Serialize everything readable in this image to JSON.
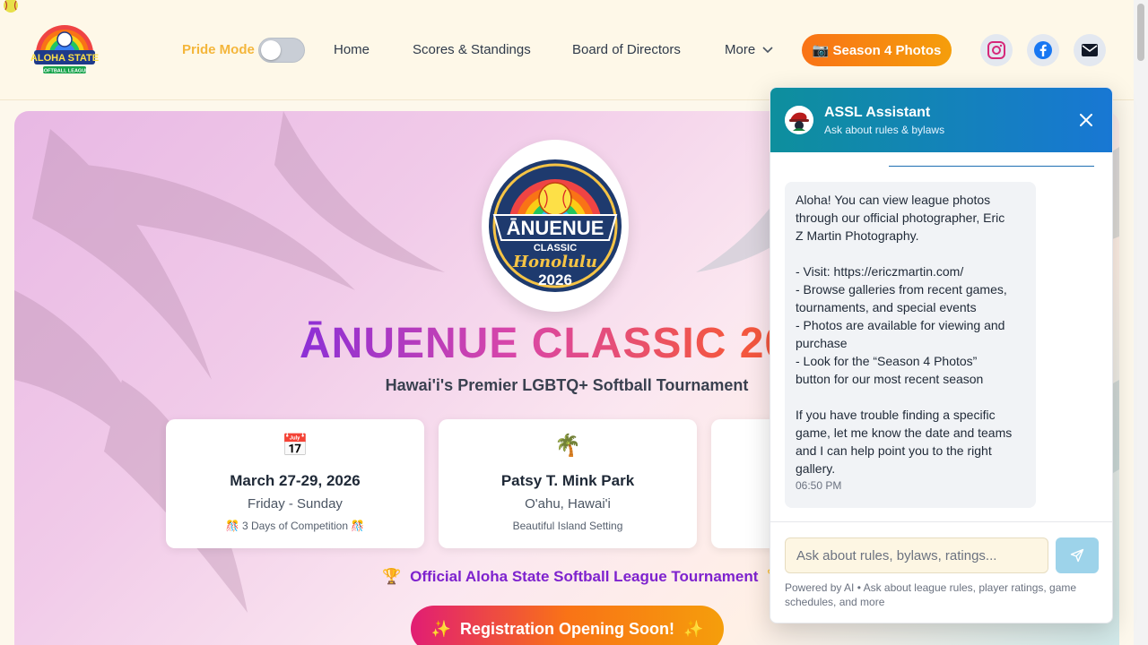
{
  "header": {
    "logo_alt": "Aloha State Softball League",
    "pride_mode_label": "Pride Mode",
    "nav": [
      {
        "label": "Home"
      },
      {
        "label": "Scores & Standings"
      },
      {
        "label": "Board of Directors"
      },
      {
        "label": "More"
      }
    ],
    "season_photos_label": "📷 Season 4 Photos",
    "social_icons": [
      "instagram-icon",
      "facebook-icon",
      "email-icon"
    ],
    "colors": {
      "accent": "#f97316",
      "pride_label": "#f4b63b"
    }
  },
  "hero": {
    "badge": {
      "line1": "ĀNUENUE",
      "line2": "CLASSIC",
      "line3": "Honolulu",
      "line4": "2026"
    },
    "title": "ĀNUENUE CLASSIC 2026",
    "subtitle": "Hawai'i's Premier LGBTQ+ Softball Tournament",
    "cards": [
      {
        "icon": "📅",
        "title": "March 27-29, 2026",
        "subtitle": "Friday - Sunday",
        "note": "🎊 3 Days of Competition 🎊"
      },
      {
        "icon": "🌴",
        "title": "Patsy T. Mink Park",
        "subtitle": "O'ahu, Hawai'i",
        "note": "Beautiful Island Setting"
      },
      {
        "icon": "",
        "title": "",
        "subtitle": "",
        "note": ""
      }
    ],
    "official_text": "Official Aloha State Softball League Tournament",
    "trophy_icon": "🏆",
    "registration_button": "Registration Opening Soon!",
    "sparkle_icon": "✨"
  },
  "chat": {
    "title": "ASSL Assistant",
    "subtitle": "Ask about rules & bylaws",
    "message_lines": [
      "Aloha! You can view league photos",
      "through our official photographer, Eric",
      "Z Martin Photography.",
      "",
      "- Visit: https://ericzmartin.com/",
      "- Browse galleries from recent games,",
      "tournaments, and special events",
      "- Photos are available for viewing and",
      "purchase",
      "- Look for the “Season 4 Photos”",
      "button for our most recent season",
      "",
      "If you have trouble finding a specific",
      "game, let me know the date and teams",
      "and I can help point you to the right",
      "gallery."
    ],
    "message_time": "06:50 PM",
    "input_placeholder": "Ask about rules, bylaws, ratings...",
    "powered_by": "Powered by AI • Ask about league rules, player ratings, game schedules, and more",
    "colors": {
      "header_start": "#0e8f9d",
      "header_end": "#1877d4",
      "send": "#9dd3ea"
    }
  }
}
